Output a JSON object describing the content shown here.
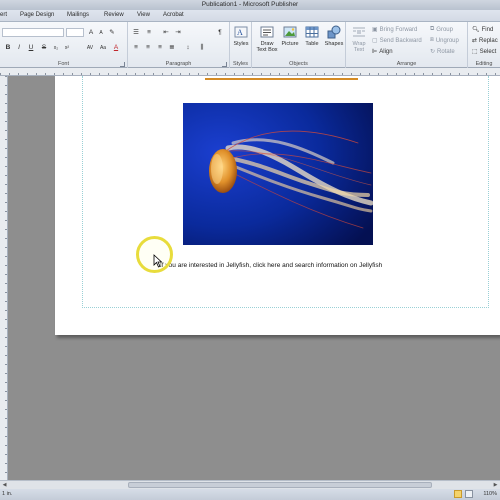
{
  "window": {
    "title": "Publication1 - Microsoft Publisher"
  },
  "tabs": [
    "ert",
    "Page Design",
    "Mailings",
    "Review",
    "View",
    "Acrobat"
  ],
  "ribbon": {
    "font": {
      "label": "Font"
    },
    "paragraph": {
      "label": "Paragraph"
    },
    "styles": {
      "label": "Styles",
      "button": "Styles"
    },
    "objects": {
      "label": "Objects",
      "draw_text_box_line1": "Draw",
      "draw_text_box_line2": "Text Box",
      "picture": "Picture",
      "table": "Table",
      "shapes": "Shapes"
    },
    "arrange": {
      "label": "Arrange",
      "wrap_text_line1": "Wrap",
      "wrap_text_line2": "Text",
      "bring_forward": "Bring Forward",
      "send_backward": "Send Backward",
      "align": "Align",
      "group": "Group",
      "ungroup": "Ungroup",
      "rotate": "Rotate"
    },
    "editing": {
      "label": "Editing",
      "find": "Find",
      "replace": "Replac",
      "select": "Select"
    }
  },
  "document": {
    "caption": "If you are interested in Jellyfish, click here and search information on Jellyfish"
  },
  "status": {
    "position": "1 in.",
    "zoom": "110%"
  },
  "colors": {
    "accent": "#d58b24",
    "picture_bg": "#0a2a9c",
    "cursor_highlight": "#e8dc3c"
  }
}
